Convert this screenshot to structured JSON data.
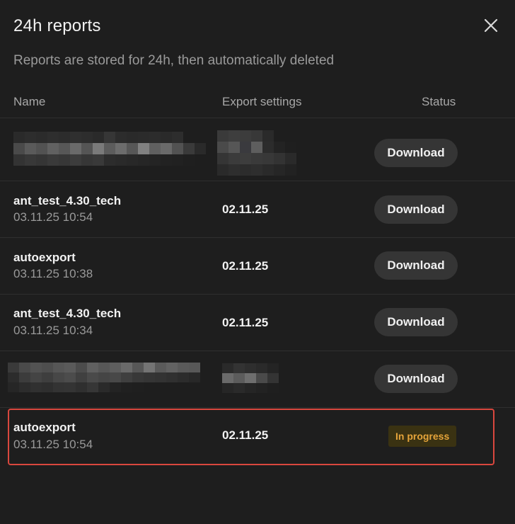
{
  "modal": {
    "title": "24h reports",
    "subtitle": "Reports are stored for 24h, then automatically deleted",
    "close_icon": "close-icon"
  },
  "table": {
    "headers": {
      "name": "Name",
      "export_settings": "Export settings",
      "status": "Status"
    },
    "rows": [
      {
        "name": "",
        "date": "",
        "export": "",
        "status": "Download",
        "redacted": true
      },
      {
        "name": "ant_test_4.30_tech",
        "date": "03.11.25 10:54",
        "export": "02.11.25",
        "status": "Download"
      },
      {
        "name": "autoexport",
        "date": "03.11.25 10:38",
        "export": "02.11.25",
        "status": "Download"
      },
      {
        "name": "ant_test_4.30_tech",
        "date": "03.11.25 10:34",
        "export": "02.11.25",
        "status": "Download"
      },
      {
        "name": "",
        "date": "",
        "export": "",
        "status": "Download",
        "redacted": true
      },
      {
        "name": "autoexport",
        "date": "03.11.25 10:54",
        "export": "02.11.25",
        "status": "In progress",
        "highlighted": true
      }
    ]
  },
  "colors": {
    "background": "#1e1e1e",
    "button": "#353535",
    "progress_text": "#e5a43a",
    "progress_bg": "#3a3212",
    "highlight_border": "#d9473e"
  }
}
